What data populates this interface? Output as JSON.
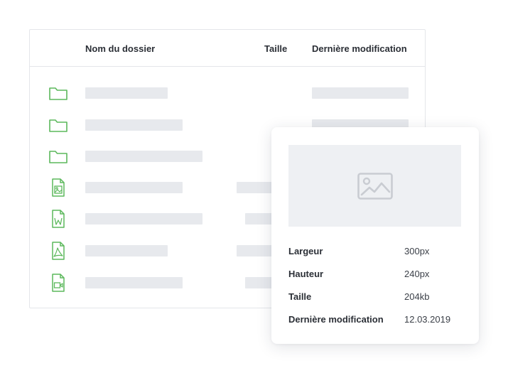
{
  "table": {
    "columns": {
      "name": "Nom du dossier",
      "size": "Taille",
      "modified": "Dernière modification"
    },
    "rows": [
      {
        "icon": "folder-icon"
      },
      {
        "icon": "folder-icon"
      },
      {
        "icon": "folder-icon"
      },
      {
        "icon": "image-file-icon"
      },
      {
        "icon": "word-file-icon"
      },
      {
        "icon": "pdf-file-icon"
      },
      {
        "icon": "video-file-icon"
      }
    ]
  },
  "preview": {
    "image_icon": "image-placeholder-icon",
    "details": [
      {
        "label": "Largeur",
        "value": "300px"
      },
      {
        "label": "Hauteur",
        "value": "240px"
      },
      {
        "label": "Taille",
        "value": "204kb"
      },
      {
        "label": "Dernière modification",
        "value": "12.03.2019"
      }
    ]
  },
  "colors": {
    "accent_green": "#5cb85c",
    "skeleton": "#e7e9ed",
    "border": "#e4e6ea"
  }
}
